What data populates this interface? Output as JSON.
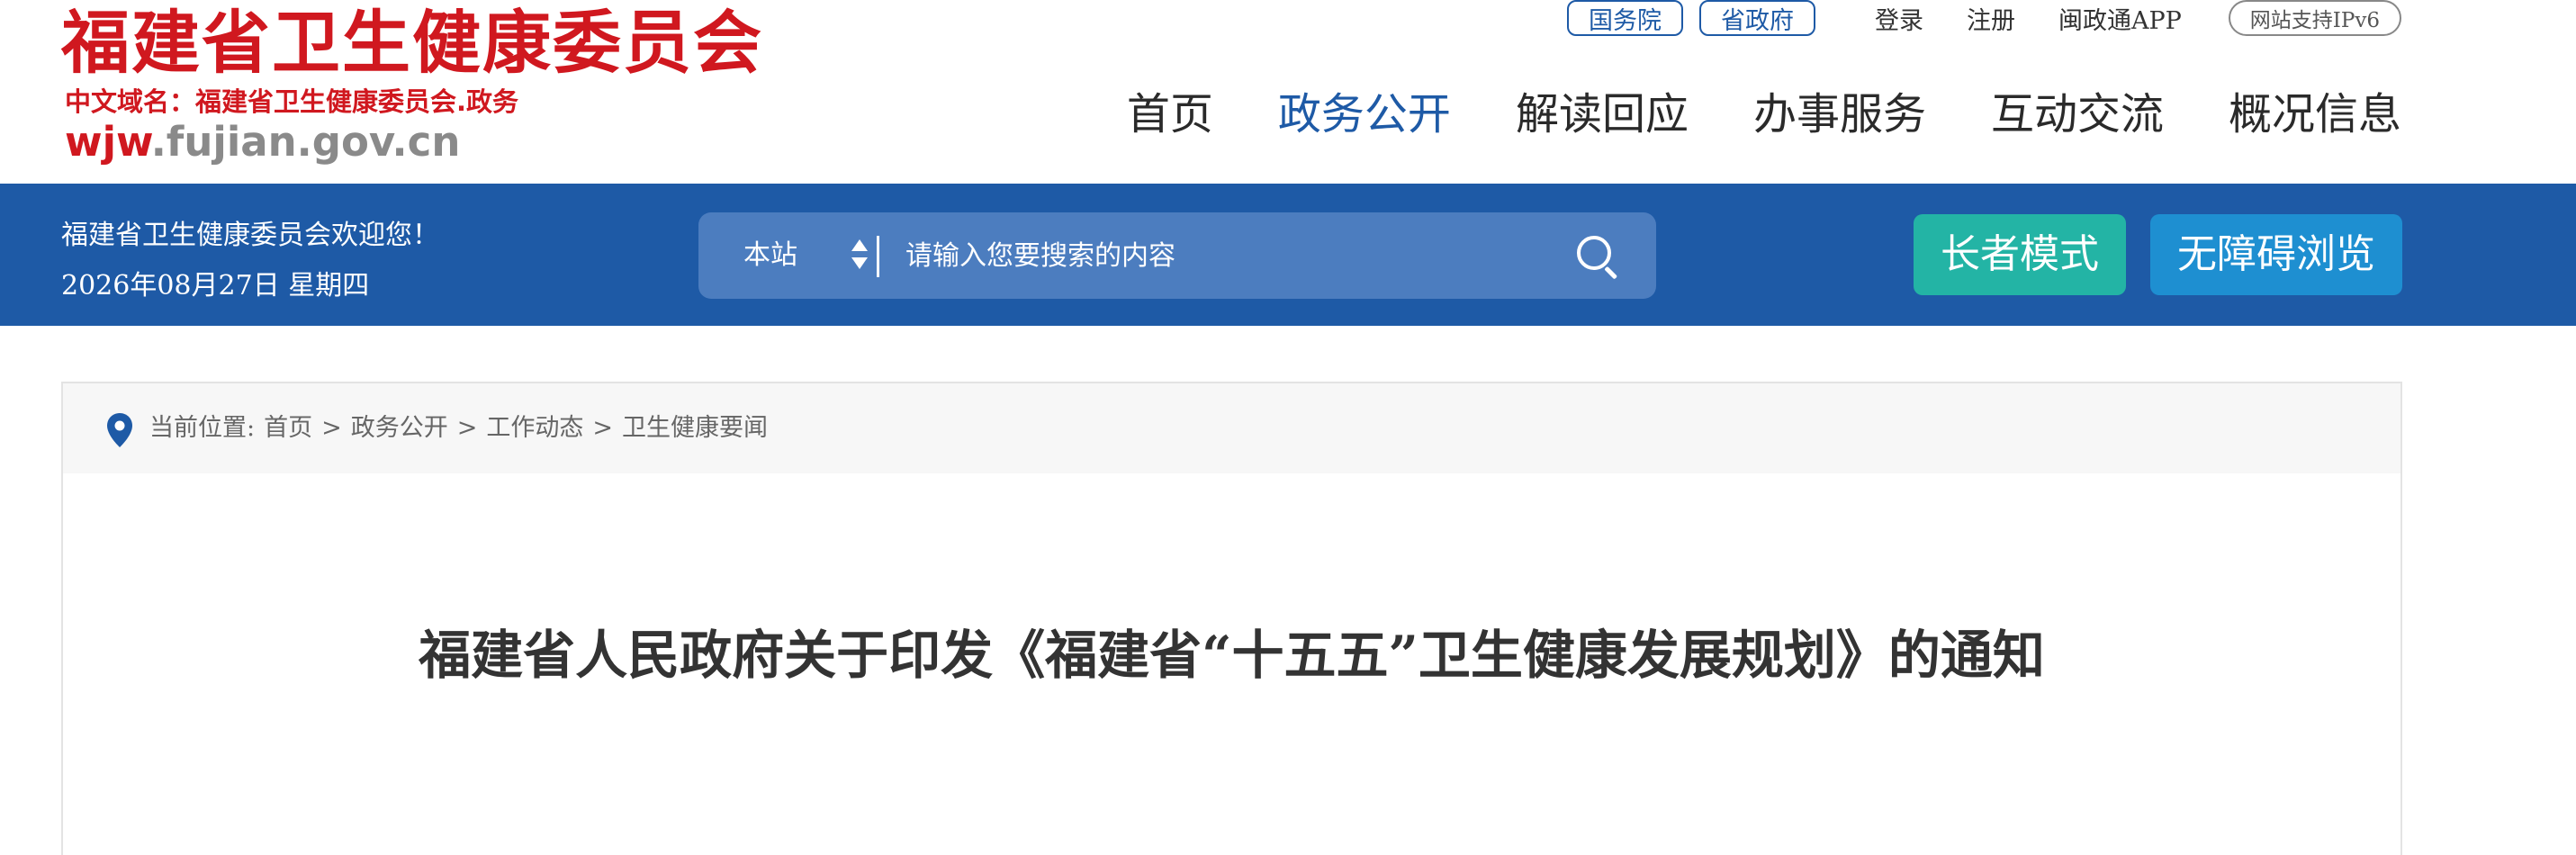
{
  "logo": {
    "title": "福建省卫生健康委员会",
    "subtitle": "中文域名：福建省卫生健康委员会.政务",
    "domain_prefix": "wjw",
    "domain_rest": ".fujian.gov.cn"
  },
  "top_links": {
    "state_council": "国务院",
    "provincial_gov": "省政府",
    "login": "登录",
    "register": "注册",
    "app": "闽政通APP",
    "ipv6": "网站支持IPv6"
  },
  "nav": [
    {
      "label": "首页",
      "active": false
    },
    {
      "label": "政务公开",
      "active": true
    },
    {
      "label": "解读回应",
      "active": false
    },
    {
      "label": "办事服务",
      "active": false
    },
    {
      "label": "互动交流",
      "active": false
    },
    {
      "label": "概况信息",
      "active": false
    }
  ],
  "bluebar": {
    "welcome": "福建省卫生健康委员会欢迎您！",
    "date": "2026年08月27日 星期四",
    "search_scope": "本站",
    "search_placeholder": "请输入您要搜索的内容",
    "elder_mode": "长者模式",
    "accessible": "无障碍浏览"
  },
  "breadcrumb": {
    "prefix": "当前位置:",
    "items": [
      "首页",
      ">",
      "政务公开",
      ">",
      "工作动态",
      ">",
      "卫生健康要闻"
    ]
  },
  "article": {
    "title": "福建省人民政府关于印发《福建省“十五五”卫生健康发展规划》的通知"
  },
  "colors": {
    "brand_red": "#d0181f",
    "primary_blue": "#1e5aa6",
    "elder_teal": "#23b4a5",
    "access_blue": "#1e8fd1"
  }
}
